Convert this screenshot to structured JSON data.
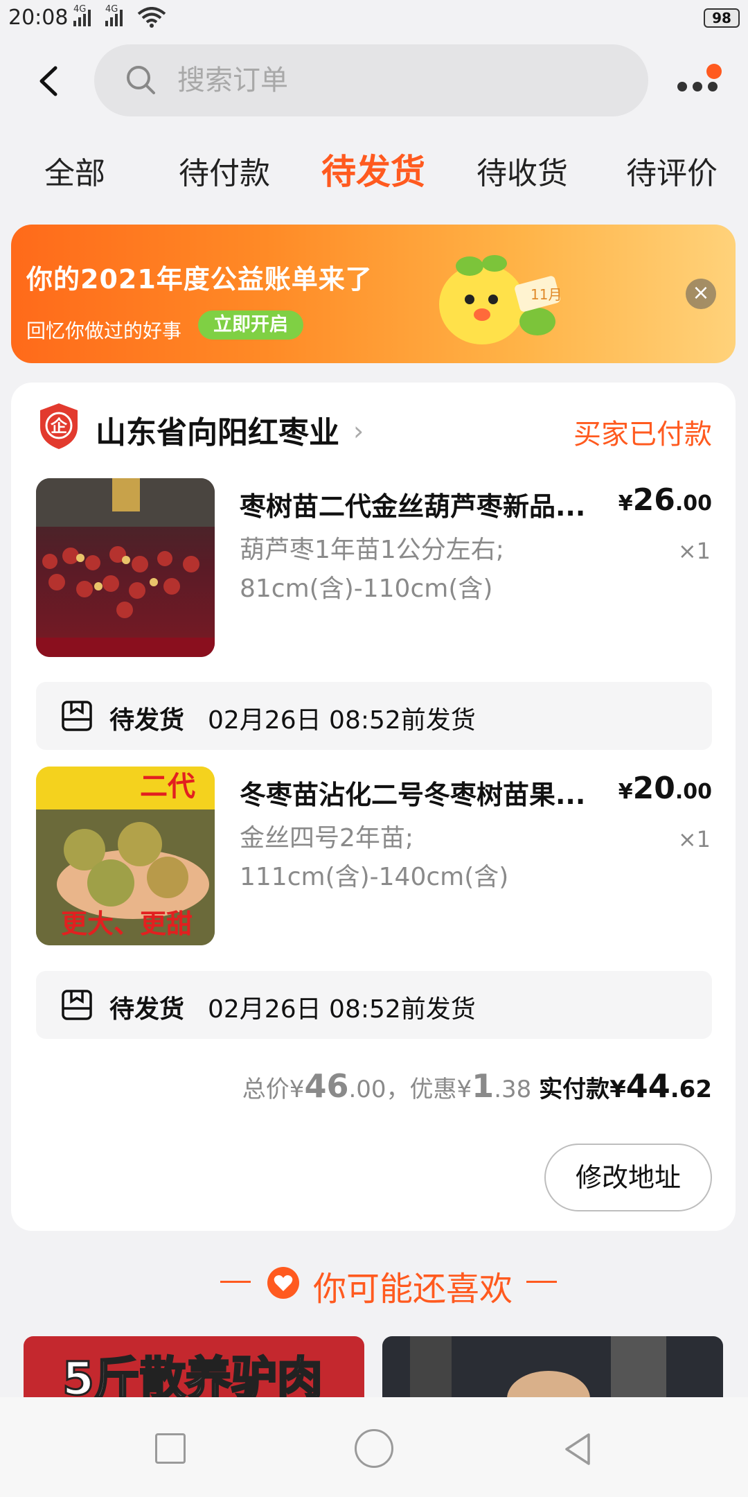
{
  "status_bar": {
    "time": "20:08",
    "network1": "4G",
    "network2": "4G",
    "battery": "98"
  },
  "search": {
    "placeholder": "搜索订单"
  },
  "tabs": [
    {
      "label": "全部",
      "active": false
    },
    {
      "label": "待付款",
      "active": false
    },
    {
      "label": "待发货",
      "active": true
    },
    {
      "label": "待收货",
      "active": false
    },
    {
      "label": "待评价",
      "active": false
    }
  ],
  "banner": {
    "title": "你的2021年度公益账单来了",
    "subtitle": "回忆你做过的好事",
    "cta": "立即开启",
    "mascot_label": "11月"
  },
  "order": {
    "shop_name": "山东省向阳红枣业",
    "shop_badge": "企",
    "status": "买家已付款",
    "items": [
      {
        "title": "枣树苗二代金丝葫芦枣新品...",
        "spec_line1": "葫芦枣1年苗1公分左右;",
        "spec_line2": "81cm(含)-110cm(含)",
        "price_symbol": "¥",
        "price_int": "26",
        "price_dec": ".00",
        "qty": "×1",
        "ship_label": "待发货",
        "ship_date": "02月26日 08:52前发货",
        "image_caption": ""
      },
      {
        "title": "冬枣苗沾化二号冬枣树苗果...",
        "spec_line1": "金丝四号2年苗;",
        "spec_line2": "111cm(含)-140cm(含)",
        "price_symbol": "¥",
        "price_int": "20",
        "price_dec": ".00",
        "qty": "×1",
        "ship_label": "待发货",
        "ship_date": "02月26日 08:52前发货",
        "image_caption": "更大、更甜",
        "image_header": "二代"
      }
    ],
    "totals": {
      "total_label": "总价",
      "total_int": "46",
      "total_dec": ".00",
      "discount_label": "，优惠",
      "discount_int": "1",
      "discount_dec": ".38",
      "paid_label": "实付款",
      "paid_int": "44",
      "paid_dec": ".62",
      "currency": "¥"
    },
    "action_button": "修改地址"
  },
  "recommend": {
    "title": "你可能还喜欢",
    "cards": [
      {
        "label": "5斤散养驴肉"
      },
      {
        "label": ""
      }
    ]
  },
  "colors": {
    "accent": "#ff5a1f",
    "bg": "#f2f2f4",
    "muted": "#8a8a8a"
  }
}
